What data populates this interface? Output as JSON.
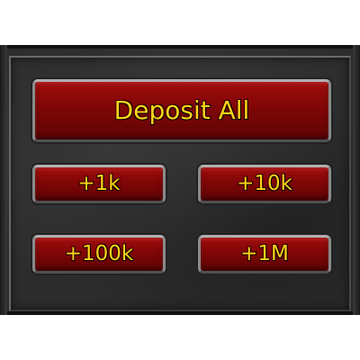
{
  "bank_panel": {
    "deposit_all_label": "Deposit All",
    "quick_deposit": [
      {
        "label": "+1k"
      },
      {
        "label": "+10k"
      },
      {
        "label": "+100k"
      },
      {
        "label": "+1M"
      }
    ]
  },
  "colors": {
    "button_red": "#800606",
    "label_gold": "#ffd21a",
    "panel_stone": "#2c2c2c"
  }
}
